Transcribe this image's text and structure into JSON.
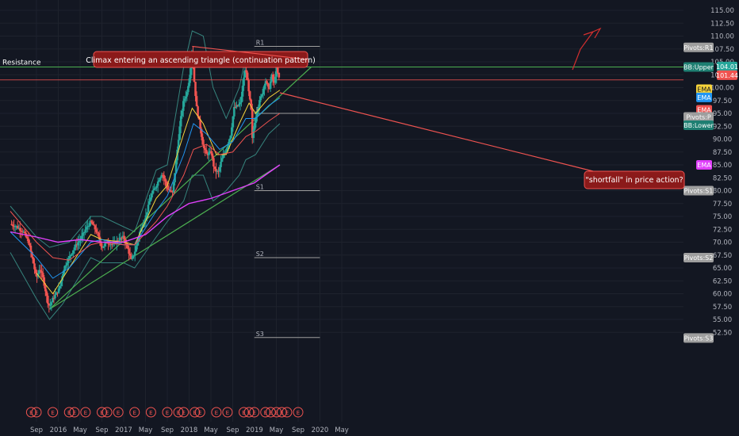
{
  "chart_data": {
    "type": "candlestick",
    "title": "",
    "xlabel": "",
    "ylabel": "",
    "ylim": [
      51,
      117
    ],
    "grid": true,
    "y_ticks": [
      52.5,
      55,
      57.5,
      60,
      62.5,
      65,
      67.5,
      70,
      72.5,
      75,
      77.5,
      80,
      82.5,
      85,
      87.5,
      90,
      92.5,
      95,
      97.5,
      100,
      102.5,
      105,
      107.5,
      110,
      112.5,
      115
    ],
    "x_ticks": [
      {
        "label": "Sep",
        "t": 0.0
      },
      {
        "label": "2016",
        "t": 0.333
      },
      {
        "label": "May",
        "t": 0.667
      },
      {
        "label": "Sep",
        "t": 1.0
      },
      {
        "label": "2017",
        "t": 1.333
      },
      {
        "label": "May",
        "t": 1.667
      },
      {
        "label": "Sep",
        "t": 2.0
      },
      {
        "label": "2018",
        "t": 2.333
      },
      {
        "label": "May",
        "t": 2.667
      },
      {
        "label": "Sep",
        "t": 3.0
      },
      {
        "label": "2019",
        "t": 3.333
      },
      {
        "label": "May",
        "t": 3.667
      },
      {
        "label": "Sep",
        "t": 4.0
      },
      {
        "label": "2020",
        "t": 4.333
      },
      {
        "label": "May",
        "t": 4.667
      }
    ],
    "price_path": [
      [
        -0.4,
        73.5
      ],
      [
        -0.3,
        73.0
      ],
      [
        -0.2,
        72.0
      ],
      [
        -0.12,
        70.0
      ],
      [
        -0.05,
        66.0
      ],
      [
        0.0,
        63.0
      ],
      [
        0.05,
        65.0
      ],
      [
        0.1,
        63.0
      ],
      [
        0.17,
        58.5
      ],
      [
        0.2,
        57.5
      ],
      [
        0.25,
        59.0
      ],
      [
        0.3,
        60.0
      ],
      [
        0.35,
        61.0
      ],
      [
        0.42,
        65.0
      ],
      [
        0.5,
        67.0
      ],
      [
        0.58,
        69.0
      ],
      [
        0.67,
        70.5
      ],
      [
        0.75,
        72.5
      ],
      [
        0.83,
        74.0
      ],
      [
        0.92,
        72.0
      ],
      [
        1.0,
        69.0
      ],
      [
        1.08,
        70.0
      ],
      [
        1.17,
        69.5
      ],
      [
        1.25,
        70.5
      ],
      [
        1.33,
        71.0
      ],
      [
        1.4,
        68.5
      ],
      [
        1.45,
        66.5
      ],
      [
        1.5,
        68.0
      ],
      [
        1.58,
        72.0
      ],
      [
        1.67,
        75.0
      ],
      [
        1.75,
        79.0
      ],
      [
        1.83,
        81.0
      ],
      [
        1.92,
        83.5
      ],
      [
        2.0,
        80.5
      ],
      [
        2.08,
        79.5
      ],
      [
        2.12,
        84.0
      ],
      [
        2.17,
        90.0
      ],
      [
        2.2,
        93.5
      ],
      [
        2.25,
        97.5
      ],
      [
        2.3,
        99.0
      ],
      [
        2.35,
        103.0
      ],
      [
        2.38,
        108.0
      ],
      [
        2.4,
        103.0
      ],
      [
        2.42,
        100.0
      ],
      [
        2.45,
        96.0
      ],
      [
        2.5,
        92.5
      ],
      [
        2.55,
        88.5
      ],
      [
        2.6,
        87.0
      ],
      [
        2.67,
        87.5
      ],
      [
        2.72,
        84.0
      ],
      [
        2.78,
        83.5
      ],
      [
        2.83,
        86.0
      ],
      [
        2.9,
        88.0
      ],
      [
        2.97,
        91.0
      ],
      [
        3.02,
        96.0
      ],
      [
        3.08,
        96.5
      ],
      [
        3.12,
        97.0
      ],
      [
        3.17,
        102.0
      ],
      [
        3.2,
        104.0
      ],
      [
        3.25,
        98.5
      ],
      [
        3.28,
        96.0
      ],
      [
        3.3,
        90.0
      ],
      [
        3.33,
        93.0
      ],
      [
        3.38,
        96.0
      ],
      [
        3.45,
        99.0
      ],
      [
        3.5,
        101.5
      ],
      [
        3.55,
        99.5
      ],
      [
        3.6,
        102.5
      ],
      [
        3.63,
        100.5
      ],
      [
        3.67,
        104.0
      ],
      [
        3.7,
        102.0
      ],
      [
        3.72,
        101.44
      ]
    ],
    "ema_fast": [
      [
        0.0,
        64.0
      ],
      [
        0.25,
        60.0
      ],
      [
        0.5,
        65.0
      ],
      [
        0.83,
        71.5
      ],
      [
        1.0,
        70.5
      ],
      [
        1.33,
        70.0
      ],
      [
        1.5,
        69.5
      ],
      [
        1.83,
        78.5
      ],
      [
        2.0,
        81.0
      ],
      [
        2.25,
        91.0
      ],
      [
        2.38,
        96.0
      ],
      [
        2.55,
        93.0
      ],
      [
        2.75,
        87.0
      ],
      [
        2.9,
        87.0
      ],
      [
        3.1,
        93.0
      ],
      [
        3.25,
        97.0
      ],
      [
        3.35,
        95.0
      ],
      [
        3.55,
        98.0
      ],
      [
        3.72,
        99.5
      ]
    ],
    "ema_mid": [
      [
        -0.4,
        72.0
      ],
      [
        0.0,
        67.0
      ],
      [
        0.25,
        63.0
      ],
      [
        0.5,
        65.0
      ],
      [
        0.83,
        70.0
      ],
      [
        1.0,
        70.5
      ],
      [
        1.33,
        69.5
      ],
      [
        1.5,
        69.5
      ],
      [
        1.83,
        76.0
      ],
      [
        2.0,
        79.0
      ],
      [
        2.25,
        87.0
      ],
      [
        2.4,
        93.0
      ],
      [
        2.6,
        91.0
      ],
      [
        2.8,
        88.0
      ],
      [
        3.0,
        89.5
      ],
      [
        3.2,
        94.0
      ],
      [
        3.35,
        94.0
      ],
      [
        3.55,
        96.5
      ],
      [
        3.72,
        98.0
      ]
    ],
    "ema_slow": [
      [
        -0.4,
        76.0
      ],
      [
        0.0,
        70.0
      ],
      [
        0.25,
        67.0
      ],
      [
        0.5,
        66.5
      ],
      [
        0.83,
        69.5
      ],
      [
        1.0,
        70.0
      ],
      [
        1.33,
        69.5
      ],
      [
        1.5,
        69.5
      ],
      [
        1.83,
        74.0
      ],
      [
        2.0,
        77.0
      ],
      [
        2.25,
        83.0
      ],
      [
        2.4,
        88.0
      ],
      [
        2.6,
        89.0
      ],
      [
        2.8,
        87.0
      ],
      [
        3.0,
        87.5
      ],
      [
        3.2,
        90.5
      ],
      [
        3.35,
        91.5
      ],
      [
        3.55,
        93.5
      ],
      [
        3.72,
        95.0
      ]
    ],
    "ema_long": [
      [
        -0.4,
        72.0
      ],
      [
        0.0,
        71.0
      ],
      [
        0.33,
        70.0
      ],
      [
        0.67,
        70.5
      ],
      [
        1.0,
        70.0
      ],
      [
        1.33,
        70.0
      ],
      [
        1.67,
        71.5
      ],
      [
        2.0,
        75.0
      ],
      [
        2.33,
        77.5
      ],
      [
        2.67,
        78.5
      ],
      [
        3.0,
        80.0
      ],
      [
        3.33,
        81.5
      ],
      [
        3.55,
        83.5
      ],
      [
        3.72,
        85.0
      ]
    ],
    "bb_upper": [
      [
        -0.4,
        77.0
      ],
      [
        0.0,
        71.0
      ],
      [
        0.2,
        69.0
      ],
      [
        0.5,
        70.0
      ],
      [
        0.83,
        75.0
      ],
      [
        1.0,
        75.0
      ],
      [
        1.33,
        73.0
      ],
      [
        1.5,
        72.0
      ],
      [
        1.83,
        84.0
      ],
      [
        2.0,
        85.0
      ],
      [
        2.25,
        104.0
      ],
      [
        2.38,
        111.0
      ],
      [
        2.55,
        110.0
      ],
      [
        2.7,
        100.0
      ],
      [
        2.9,
        94.0
      ],
      [
        3.1,
        100.0
      ],
      [
        3.2,
        106.0
      ],
      [
        3.35,
        106.0
      ],
      [
        3.55,
        105.0
      ],
      [
        3.72,
        105.0
      ]
    ],
    "bb_lower": [
      [
        -0.4,
        68.0
      ],
      [
        0.0,
        59.0
      ],
      [
        0.2,
        55.0
      ],
      [
        0.4,
        58.0
      ],
      [
        0.83,
        67.0
      ],
      [
        1.0,
        66.0
      ],
      [
        1.33,
        66.0
      ],
      [
        1.5,
        65.0
      ],
      [
        1.83,
        71.0
      ],
      [
        2.0,
        74.0
      ],
      [
        2.25,
        78.0
      ],
      [
        2.38,
        83.0
      ],
      [
        2.55,
        83.0
      ],
      [
        2.7,
        78.0
      ],
      [
        2.9,
        80.0
      ],
      [
        3.1,
        83.0
      ],
      [
        3.2,
        86.0
      ],
      [
        3.35,
        87.0
      ],
      [
        3.55,
        91.0
      ],
      [
        3.72,
        93.0
      ]
    ],
    "trendlines": [
      {
        "points": [
          [
            0.2,
            57.0
          ],
          [
            3.72,
            85.0
          ]
        ],
        "color": "#4caf50"
      },
      {
        "points": [
          [
            0.2,
            57.0
          ],
          [
            4.2,
            104.0
          ]
        ],
        "color": "#4caf50"
      },
      {
        "points": [
          [
            -0.5,
            104.0
          ],
          [
            4.333,
            104.0
          ]
        ],
        "color": "#4caf50"
      }
    ],
    "red_hline": {
      "y": 101.5,
      "color": "#ef5350"
    },
    "pivot_lines": [
      {
        "label": "R1",
        "y": 108.0,
        "x": [
          3.33,
          4.333
        ]
      },
      {
        "label": "P",
        "y": 95.0,
        "x": [
          3.33,
          4.333
        ]
      },
      {
        "label": "S1",
        "y": 80.0,
        "x": [
          3.33,
          4.333
        ]
      },
      {
        "label": "S2",
        "y": 67.0,
        "x": [
          3.33,
          4.333
        ]
      },
      {
        "label": "S3",
        "y": 51.5,
        "x": [
          3.33,
          4.333
        ]
      }
    ],
    "event_markers_t": [
      -0.08,
      0.0,
      0.25,
      0.5,
      0.58,
      0.75,
      1.0,
      1.08,
      1.25,
      1.5,
      1.75,
      2.0,
      2.17,
      2.25,
      2.42,
      2.5,
      2.75,
      2.92,
      3.17,
      3.25,
      3.33,
      3.5,
      3.58,
      3.67,
      3.75,
      3.83,
      4.0
    ],
    "annotations": [
      {
        "text": "Climax entering an ascending triangle (continuation pattern)",
        "arrow_to": [
          2.38,
          108.0
        ]
      },
      {
        "text": "\"shortfall\" in price action?",
        "arrow_from": [
          3.72,
          99.0
        ]
      }
    ],
    "labels": {
      "resistance": "Resistance",
      "event": "E",
      "pivot_r1": "R1",
      "pivot_p": "P",
      "pivot_s1": "S1",
      "pivot_s2": "S2",
      "pivot_s3": "S3"
    },
    "price_tags": [
      {
        "text": "Pivots:R1",
        "y": 107.8,
        "bg": "#9e9e9e",
        "fg": "#ffffff",
        "col": "legend"
      },
      {
        "text": "BB:Upper",
        "y": 104.0,
        "bg": "#1e7f72",
        "fg": "#ffffff",
        "col": "legend"
      },
      {
        "text": "104.01",
        "y": 104.1,
        "bg": "#26a69a",
        "fg": "#ffffff",
        "col": "value"
      },
      {
        "text": "101.44",
        "y": 102.4,
        "bg": "#ef5350",
        "fg": "#ffffff",
        "col": "value"
      },
      {
        "text": "EMA",
        "y": 99.7,
        "bg": "#f7d43b",
        "fg": "#131722",
        "col": "legend-short"
      },
      {
        "text": "EMA",
        "y": 98.1,
        "bg": "#2196f3",
        "fg": "#ffffff",
        "col": "legend-short"
      },
      {
        "text": "EMA",
        "y": 95.7,
        "bg": "#ef5350",
        "fg": "#ffffff",
        "col": "legend-short"
      },
      {
        "text": "Pivots:P",
        "y": 94.3,
        "bg": "#9e9e9e",
        "fg": "#ffffff",
        "col": "legend"
      },
      {
        "text": "BB:Lower",
        "y": 92.7,
        "bg": "#1e7f72",
        "fg": "#ffffff",
        "col": "legend"
      },
      {
        "text": "EMA",
        "y": 85.0,
        "bg": "#e040fb",
        "fg": "#ffffff",
        "col": "legend-short"
      },
      {
        "text": "Pivots:S1",
        "y": 80.0,
        "bg": "#9e9e9e",
        "fg": "#ffffff",
        "col": "legend"
      },
      {
        "text": "Pivots:S2",
        "y": 67.0,
        "bg": "#9e9e9e",
        "fg": "#ffffff",
        "col": "legend"
      },
      {
        "text": "Pivots:S3",
        "y": 51.4,
        "bg": "#9e9e9e",
        "fg": "#ffffff",
        "col": "legend"
      }
    ]
  },
  "colors": {
    "background": "#131722",
    "grid": "#1e222d",
    "up": "#26a69a",
    "down": "#ef5350",
    "ema_fast": "#f7d43b",
    "ema_mid": "#2196f3",
    "ema_slow": "#ef5350",
    "ema_long": "#e040fb",
    "bb": "#3a8f86",
    "pivot": "#9e9e9e",
    "annotation_bg": "#8b1a1a",
    "annotation_border": "#ef5350"
  }
}
